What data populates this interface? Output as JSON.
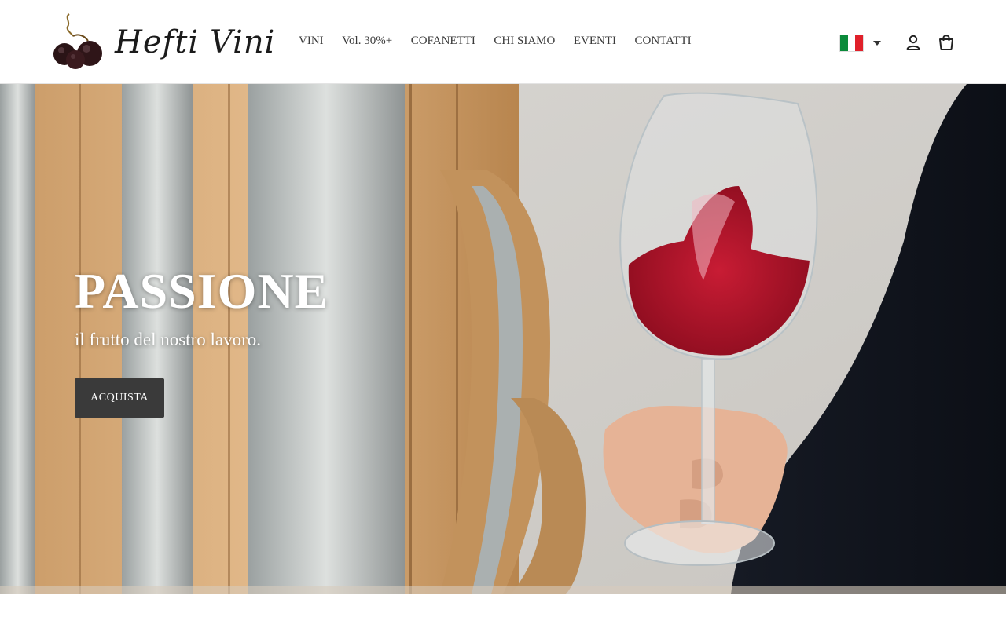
{
  "brand": {
    "name": "Hefti Vini",
    "logo_icon": "grapes-icon"
  },
  "nav": {
    "items": [
      {
        "label": "VINI"
      },
      {
        "label": "Vol. 30%+"
      },
      {
        "label": "COFANETTI"
      },
      {
        "label": "CHI SIAMO"
      },
      {
        "label": "EVENTI"
      },
      {
        "label": "CONTATTI"
      }
    ]
  },
  "header_icons": {
    "language_flag": "italy-flag-icon",
    "flag_colors": [
      "#0a8a3a",
      "#ffffff",
      "#e0202a"
    ],
    "account": "user-icon",
    "cart": "shopping-bag-icon"
  },
  "hero": {
    "title": "PASSIONE",
    "subtitle": "il frutto del nostro lavoro.",
    "button_label": "ACQUISTA",
    "button_color": "#3a3a3a"
  }
}
